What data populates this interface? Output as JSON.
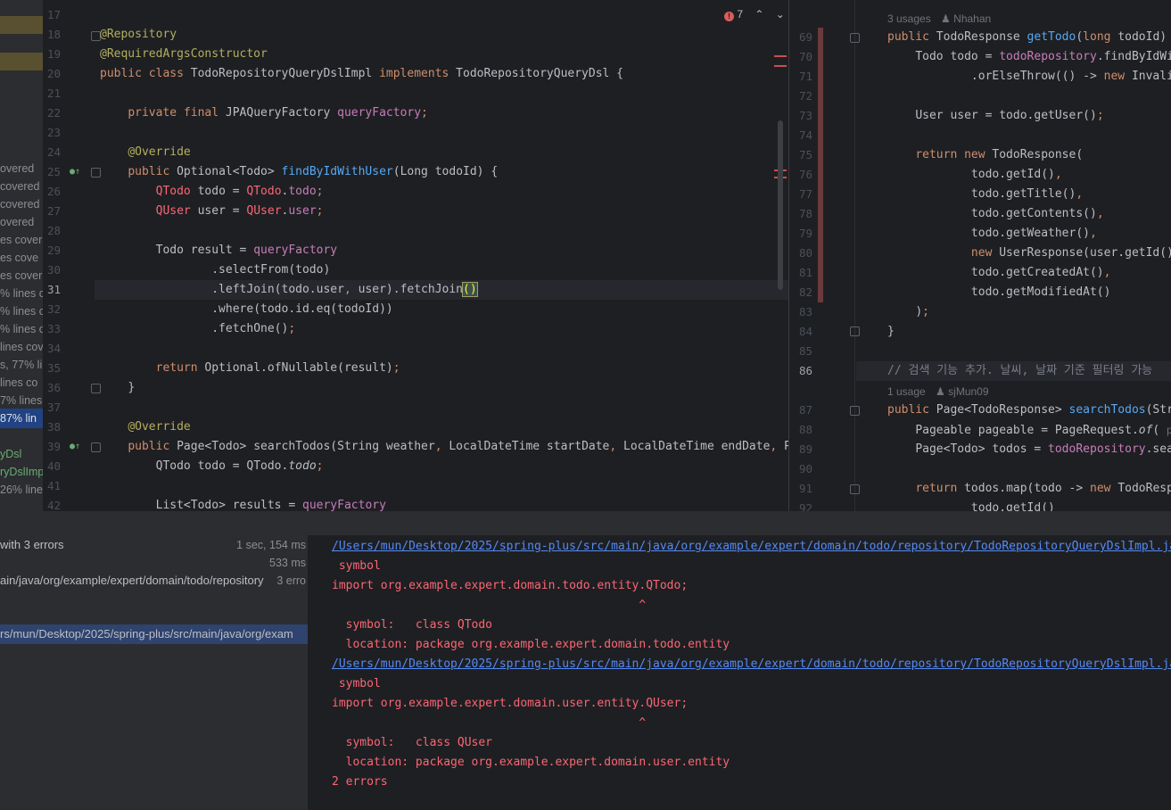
{
  "coverage": {
    "lines": [
      "overed",
      "covered",
      "covered",
      "overed",
      "es cover",
      "es cove",
      "es cover",
      "% lines c",
      "% lines c",
      "% lines c",
      "lines cov",
      "s, 77% li",
      "lines co",
      "7% lines",
      "87% lin",
      "",
      "yDsl",
      "ryDslImp",
      "26% line"
    ],
    "highlight_index": 14,
    "green_indices": [
      16,
      17
    ]
  },
  "editor_left": {
    "problems_count": "7",
    "line_numbers": [
      "17",
      "18",
      "19",
      "20",
      "21",
      "22",
      "23",
      "24",
      "25",
      "26",
      "27",
      "28",
      "29",
      "30",
      "31",
      "32",
      "33",
      "34",
      "35",
      "36",
      "37",
      "38",
      "39",
      "40",
      "41",
      "42"
    ],
    "current_line": "31"
  },
  "editor_right": {
    "usages_1": "3 usages",
    "author_1": "Nhahan",
    "usages_2": "1 usage",
    "author_2": "sjMun09",
    "line_numbers": [
      "69",
      "70",
      "71",
      "72",
      "73",
      "74",
      "75",
      "76",
      "77",
      "78",
      "79",
      "80",
      "81",
      "82",
      "83",
      "84",
      "85",
      "86",
      "87",
      "88",
      "89",
      "90",
      "91",
      "92"
    ],
    "current_line": "86",
    "param_hint": "p"
  },
  "build": {
    "status": "with 3 errors",
    "time_1": "1 sec, 154 ms",
    "time_2": "533 ms",
    "path_1": "ain/java/org/example/expert/domain/todo/repository",
    "path_1_count": "3 erro",
    "path_2": "rs/mun/Desktop/2025/spring-plus/src/main/java/org/exam"
  },
  "console": {
    "link_1": "/Users/mun/Desktop/2025/spring-plus/src/main/java/org/example/expert/domain/todo/repository/TodoRepositoryQueryDslImpl.java",
    "symbol_1": " symbol",
    "import_1": "import org.example.expert.domain.todo.entity.QTodo;",
    "caret_1": "                                            ^",
    "sym_line_1": "  symbol:   class QTodo",
    "loc_line_1": "  location: package org.example.expert.domain.todo.entity",
    "link_2": "/Users/mun/Desktop/2025/spring-plus/src/main/java/org/example/expert/domain/todo/repository/TodoRepositoryQueryDslImpl.java",
    "symbol_2": " symbol",
    "import_2": "import org.example.expert.domain.user.entity.QUser;",
    "caret_2": "                                            ^",
    "sym_line_2": "  symbol:   class QUser",
    "loc_line_2": "  location: package org.example.expert.domain.user.entity",
    "summary": "2 errors"
  },
  "colors": {
    "background": "#1e1f22",
    "keyword": "#cf8e6d",
    "annotation": "#b3ae60",
    "function": "#56a8f5",
    "field": "#c77dbb",
    "error": "#fa6675",
    "link": "#548af7"
  },
  "icons": [
    "error-icon",
    "chevron-up-icon",
    "chevron-down-icon",
    "override-icon",
    "fold-icon",
    "user-icon"
  ]
}
